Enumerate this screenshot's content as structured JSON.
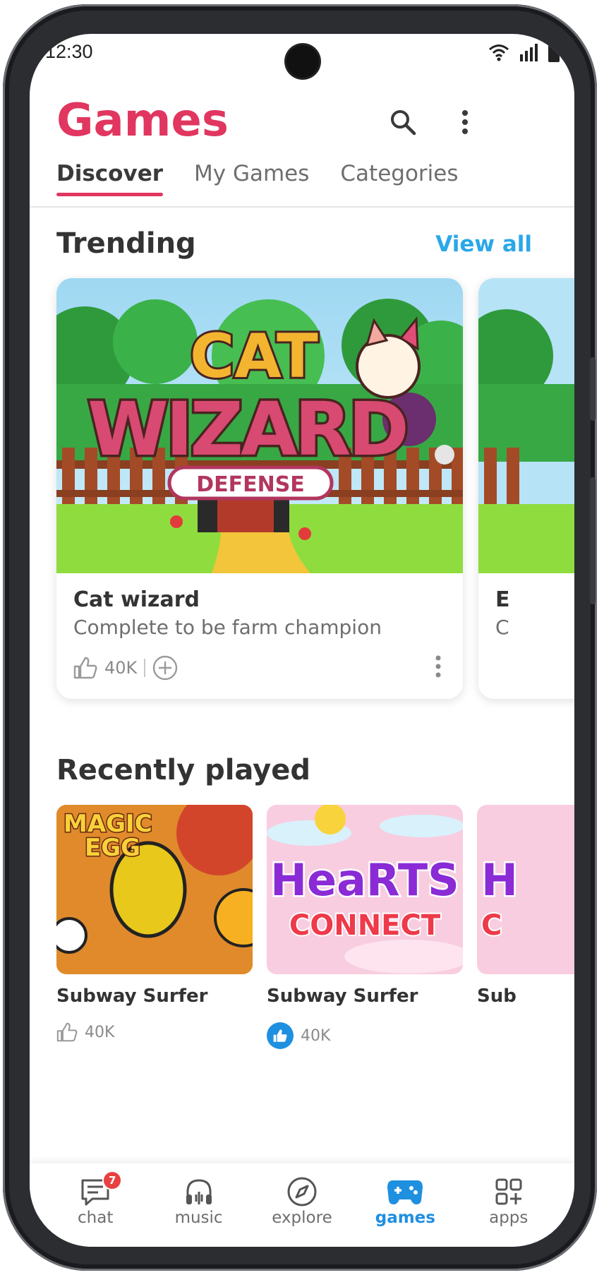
{
  "status_bar": {
    "time": "12:30"
  },
  "header": {
    "title": "Games"
  },
  "tabs": [
    {
      "label": "Discover",
      "active": true
    },
    {
      "label": "My Games",
      "active": false
    },
    {
      "label": "Categories",
      "active": false
    }
  ],
  "trending": {
    "title": "Trending",
    "view_all": "View all",
    "cards": [
      {
        "art_logo": [
          "CAT",
          "WIZARD",
          "DEFENSE"
        ],
        "title": "Cat wizard",
        "subtitle": "Complete to be farm champion",
        "likes": "40K"
      },
      {
        "title": "E",
        "subtitle": "C"
      }
    ]
  },
  "recently_played": {
    "title": "Recently played",
    "cards": [
      {
        "art_logo": [
          "MAGIC",
          "EGG"
        ],
        "title": "Subway Surfer",
        "likes": "40K"
      },
      {
        "art_logo": [
          "HeaRTS",
          "CONNECT"
        ],
        "title": "Subway Surfer",
        "likes": "40K"
      },
      {
        "art_logo": [
          "H",
          "C"
        ],
        "title": "Sub"
      }
    ]
  },
  "bottom_nav": {
    "items": [
      {
        "label": "chat",
        "icon": "chat-icon",
        "badge": "7"
      },
      {
        "label": "music",
        "icon": "headphones-icon"
      },
      {
        "label": "explore",
        "icon": "compass-icon"
      },
      {
        "label": "games",
        "icon": "gamepad-icon",
        "active": true
      },
      {
        "label": "apps",
        "icon": "apps-icon"
      }
    ]
  },
  "colors": {
    "brand": "#e0365f",
    "link": "#2aa8e8",
    "active_nav": "#1f8fe0",
    "badge": "#e84040"
  }
}
